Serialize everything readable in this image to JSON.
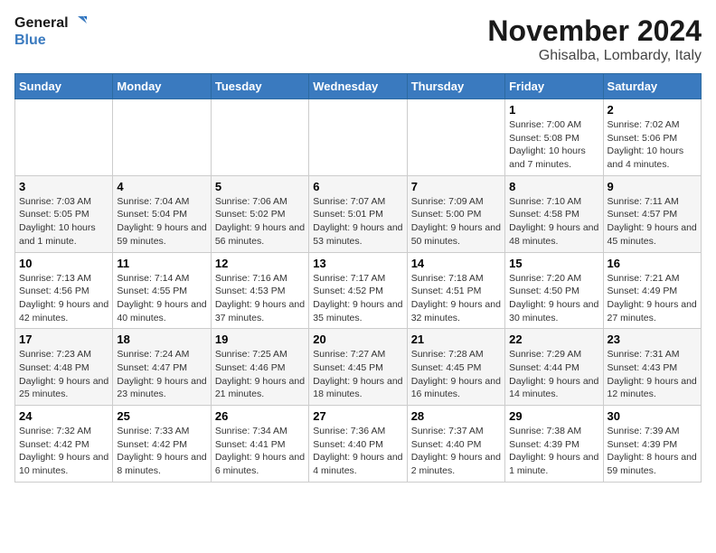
{
  "header": {
    "logo_line1": "General",
    "logo_line2": "Blue",
    "month": "November 2024",
    "location": "Ghisalba, Lombardy, Italy"
  },
  "weekdays": [
    "Sunday",
    "Monday",
    "Tuesday",
    "Wednesday",
    "Thursday",
    "Friday",
    "Saturday"
  ],
  "weeks": [
    [
      {
        "day": "",
        "info": ""
      },
      {
        "day": "",
        "info": ""
      },
      {
        "day": "",
        "info": ""
      },
      {
        "day": "",
        "info": ""
      },
      {
        "day": "",
        "info": ""
      },
      {
        "day": "1",
        "info": "Sunrise: 7:00 AM\nSunset: 5:08 PM\nDaylight: 10 hours and 7 minutes."
      },
      {
        "day": "2",
        "info": "Sunrise: 7:02 AM\nSunset: 5:06 PM\nDaylight: 10 hours and 4 minutes."
      }
    ],
    [
      {
        "day": "3",
        "info": "Sunrise: 7:03 AM\nSunset: 5:05 PM\nDaylight: 10 hours and 1 minute."
      },
      {
        "day": "4",
        "info": "Sunrise: 7:04 AM\nSunset: 5:04 PM\nDaylight: 9 hours and 59 minutes."
      },
      {
        "day": "5",
        "info": "Sunrise: 7:06 AM\nSunset: 5:02 PM\nDaylight: 9 hours and 56 minutes."
      },
      {
        "day": "6",
        "info": "Sunrise: 7:07 AM\nSunset: 5:01 PM\nDaylight: 9 hours and 53 minutes."
      },
      {
        "day": "7",
        "info": "Sunrise: 7:09 AM\nSunset: 5:00 PM\nDaylight: 9 hours and 50 minutes."
      },
      {
        "day": "8",
        "info": "Sunrise: 7:10 AM\nSunset: 4:58 PM\nDaylight: 9 hours and 48 minutes."
      },
      {
        "day": "9",
        "info": "Sunrise: 7:11 AM\nSunset: 4:57 PM\nDaylight: 9 hours and 45 minutes."
      }
    ],
    [
      {
        "day": "10",
        "info": "Sunrise: 7:13 AM\nSunset: 4:56 PM\nDaylight: 9 hours and 42 minutes."
      },
      {
        "day": "11",
        "info": "Sunrise: 7:14 AM\nSunset: 4:55 PM\nDaylight: 9 hours and 40 minutes."
      },
      {
        "day": "12",
        "info": "Sunrise: 7:16 AM\nSunset: 4:53 PM\nDaylight: 9 hours and 37 minutes."
      },
      {
        "day": "13",
        "info": "Sunrise: 7:17 AM\nSunset: 4:52 PM\nDaylight: 9 hours and 35 minutes."
      },
      {
        "day": "14",
        "info": "Sunrise: 7:18 AM\nSunset: 4:51 PM\nDaylight: 9 hours and 32 minutes."
      },
      {
        "day": "15",
        "info": "Sunrise: 7:20 AM\nSunset: 4:50 PM\nDaylight: 9 hours and 30 minutes."
      },
      {
        "day": "16",
        "info": "Sunrise: 7:21 AM\nSunset: 4:49 PM\nDaylight: 9 hours and 27 minutes."
      }
    ],
    [
      {
        "day": "17",
        "info": "Sunrise: 7:23 AM\nSunset: 4:48 PM\nDaylight: 9 hours and 25 minutes."
      },
      {
        "day": "18",
        "info": "Sunrise: 7:24 AM\nSunset: 4:47 PM\nDaylight: 9 hours and 23 minutes."
      },
      {
        "day": "19",
        "info": "Sunrise: 7:25 AM\nSunset: 4:46 PM\nDaylight: 9 hours and 21 minutes."
      },
      {
        "day": "20",
        "info": "Sunrise: 7:27 AM\nSunset: 4:45 PM\nDaylight: 9 hours and 18 minutes."
      },
      {
        "day": "21",
        "info": "Sunrise: 7:28 AM\nSunset: 4:45 PM\nDaylight: 9 hours and 16 minutes."
      },
      {
        "day": "22",
        "info": "Sunrise: 7:29 AM\nSunset: 4:44 PM\nDaylight: 9 hours and 14 minutes."
      },
      {
        "day": "23",
        "info": "Sunrise: 7:31 AM\nSunset: 4:43 PM\nDaylight: 9 hours and 12 minutes."
      }
    ],
    [
      {
        "day": "24",
        "info": "Sunrise: 7:32 AM\nSunset: 4:42 PM\nDaylight: 9 hours and 10 minutes."
      },
      {
        "day": "25",
        "info": "Sunrise: 7:33 AM\nSunset: 4:42 PM\nDaylight: 9 hours and 8 minutes."
      },
      {
        "day": "26",
        "info": "Sunrise: 7:34 AM\nSunset: 4:41 PM\nDaylight: 9 hours and 6 minutes."
      },
      {
        "day": "27",
        "info": "Sunrise: 7:36 AM\nSunset: 4:40 PM\nDaylight: 9 hours and 4 minutes."
      },
      {
        "day": "28",
        "info": "Sunrise: 7:37 AM\nSunset: 4:40 PM\nDaylight: 9 hours and 2 minutes."
      },
      {
        "day": "29",
        "info": "Sunrise: 7:38 AM\nSunset: 4:39 PM\nDaylight: 9 hours and 1 minute."
      },
      {
        "day": "30",
        "info": "Sunrise: 7:39 AM\nSunset: 4:39 PM\nDaylight: 8 hours and 59 minutes."
      }
    ]
  ]
}
